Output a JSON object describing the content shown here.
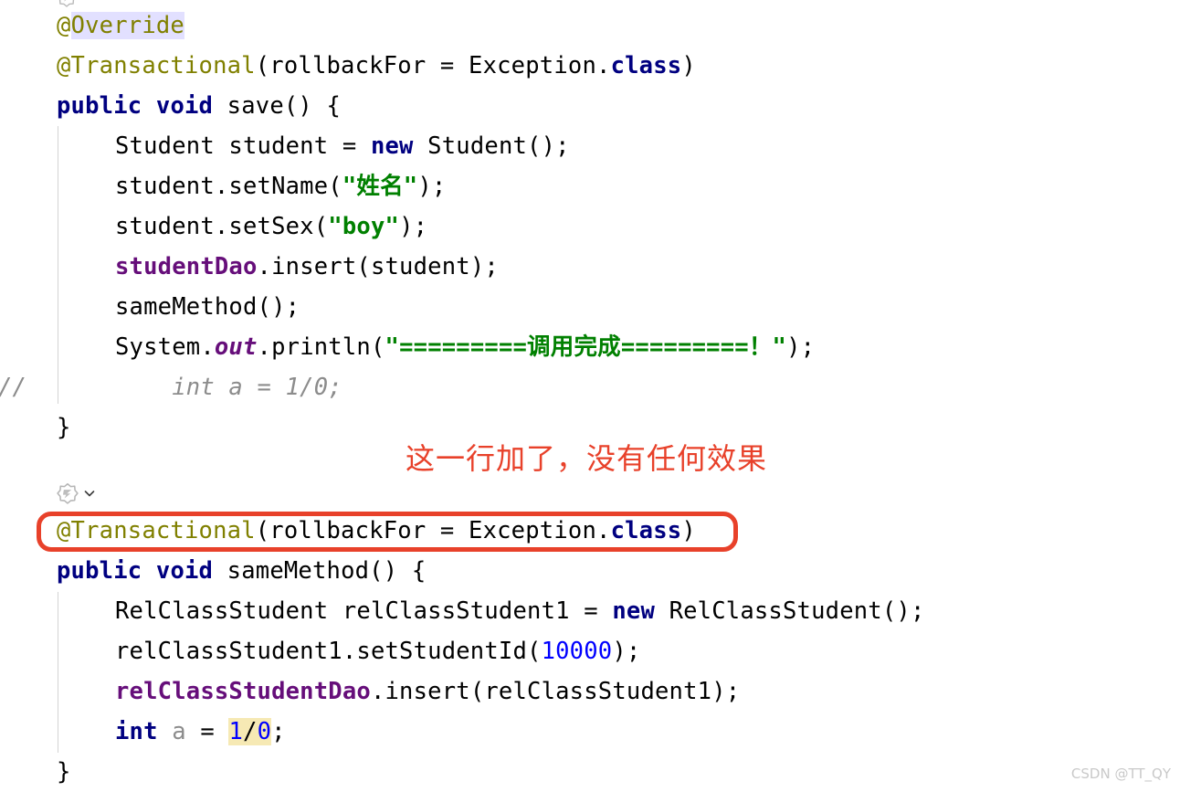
{
  "editor": {
    "language": "Java",
    "background_color": "#ffffff",
    "font_size_px": 25.5,
    "line_height_px": 44,
    "colors": {
      "annotation": "#808000",
      "keyword": "#000080",
      "string": "#008000",
      "number": "#0000ff",
      "field": "#660e7a",
      "comment": "#8c8c8c",
      "plain": "#000000",
      "identifier_highlight": "#e2e0ff",
      "warning_highlight": "#f6e9b4",
      "indent_guide": "#d4d4d4",
      "annotation_red": "#e8412a",
      "watermark": "#c9c9c9"
    }
  },
  "lines": {
    "l1": {
      "annotation_at": "@",
      "annotation_name": "Override"
    },
    "l2": {
      "annotation": "@Transactional",
      "open": "(",
      "attr": "rollbackFor = Exception.",
      "class_kw": "class",
      "close": ")"
    },
    "l3": {
      "kw1": "public",
      "kw2": "void",
      "sig": " save() {"
    },
    "l4": {
      "pre": "Student student = ",
      "kw": "new",
      "post": " Student();"
    },
    "l5": {
      "pre": "student.setName(",
      "str": "\"姓名\"",
      "post": ");"
    },
    "l6": {
      "pre": "student.setSex(",
      "str": "\"boy\"",
      "post": ");"
    },
    "l7": {
      "field": "studentDao",
      "rest": ".insert(student);"
    },
    "l8": {
      "text": "sameMethod();"
    },
    "l9": {
      "pre": "System.",
      "static_field": "out",
      "mid": ".println(",
      "str": "\"=========调用完成=========！\"",
      "post": ");"
    },
    "l10": {
      "marker": "//",
      "comment": "    int a = 1/0;"
    },
    "l11": {
      "text": "}"
    },
    "l12": {
      "annotation": "@Transactional",
      "open": "(",
      "attr": "rollbackFor = Exception.",
      "class_kw": "class",
      "close": ")"
    },
    "l13": {
      "kw1": "public",
      "kw2": "void",
      "sig": " sameMethod() {"
    },
    "l14": {
      "pre": "RelClassStudent relClassStudent1 = ",
      "kw": "new",
      "post": " RelClassStudent();"
    },
    "l15": {
      "pre": "relClassStudent1.setStudentId(",
      "num": "10000",
      "post": ");"
    },
    "l16": {
      "field": "relClassStudentDao",
      "rest": ".insert(relClassStudent1);"
    },
    "l17": {
      "kw": "int",
      "param": " a ",
      "eq": "= ",
      "num1": "1",
      "slash": "/",
      "num0": "0",
      "semi": ";"
    },
    "l18": {
      "text": "}"
    }
  },
  "gutter": {
    "spring_icon_label": "spring-bean-gutter-icon",
    "chevron_label": "chevron-down-icon"
  },
  "annotations": {
    "note_text": "这一行加了，没有任何效果",
    "box_target": "@Transactional(rollbackFor = Exception.class)"
  },
  "watermark": {
    "text": "CSDN @TT_QY"
  }
}
